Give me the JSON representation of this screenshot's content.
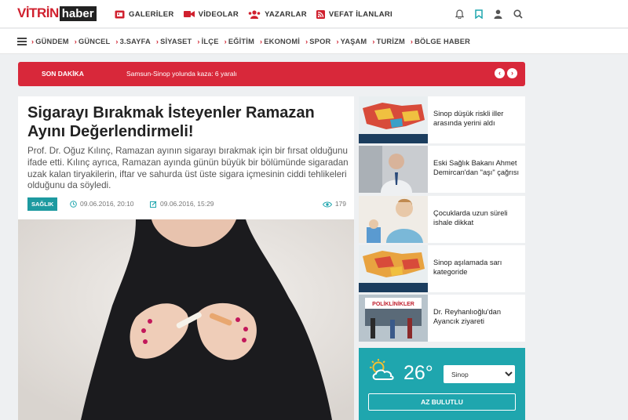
{
  "logo": {
    "part1": "VİTRİN",
    "part2": "haber"
  },
  "topnav": [
    {
      "label": "GALERİLER",
      "icon": "gallery-icon"
    },
    {
      "label": "VİDEOLAR",
      "icon": "video-icon"
    },
    {
      "label": "YAZARLAR",
      "icon": "authors-icon"
    },
    {
      "label": "VEFAT İLANLARI",
      "icon": "rss-icon"
    }
  ],
  "topicons": [
    "bell-icon",
    "bookmark-icon",
    "user-icon",
    "search-icon"
  ],
  "categories": [
    "GÜNDEM",
    "GÜNCEL",
    "3.SAYFA",
    "SİYASET",
    "İLÇE",
    "EĞİTİM",
    "EKONOMİ",
    "SPOR",
    "YAŞAM",
    "TURİZM",
    "BÖLGE HABER"
  ],
  "breaking": {
    "label": "SON DAKİKA",
    "text": "Samsun-Sinop yolunda kaza: 6 yaralı"
  },
  "article": {
    "title": "Sigarayı Bırakmak İsteyenler Ramazan Ayını Değerlendirmeli!",
    "summary": "Prof. Dr. Oğuz Kılınç, Ramazan ayının sigarayı bırakmak için bir fırsat olduğunu ifade etti. Kılınç ayrıca, Ramazan ayında günün büyük bir bölümünde sigaradan uzak kalan tiryakilerin, iftar ve sahurda üst üste sigara içmesinin ciddi tehlikeleri olduğunu da söyledi.",
    "category": "SAĞLIK",
    "published": "09.06.2016, 20:10",
    "updated": "09.06.2016, 15:29",
    "views": "179"
  },
  "sidebar": [
    {
      "caption": "Sinop düşük riskli iller arasında yerini aldı"
    },
    {
      "caption": "Eski Sağlık Bakanı Ahmet Demircan'dan \"aşı\" çağrısı"
    },
    {
      "caption": "Çocuklarda uzun süreli ishale dikkat"
    },
    {
      "caption": "Sinop aşılamada sarı kategoride"
    },
    {
      "caption": "Dr. Reyhanlıoğlu'dan Ayancık ziyareti"
    }
  ],
  "weather": {
    "temp": "26°",
    "city": "Sinop",
    "condition": "AZ BULUTLU"
  },
  "colors": {
    "brand": "#d0202e",
    "accent": "#1fa6ae",
    "breaking": "#d8283a"
  }
}
